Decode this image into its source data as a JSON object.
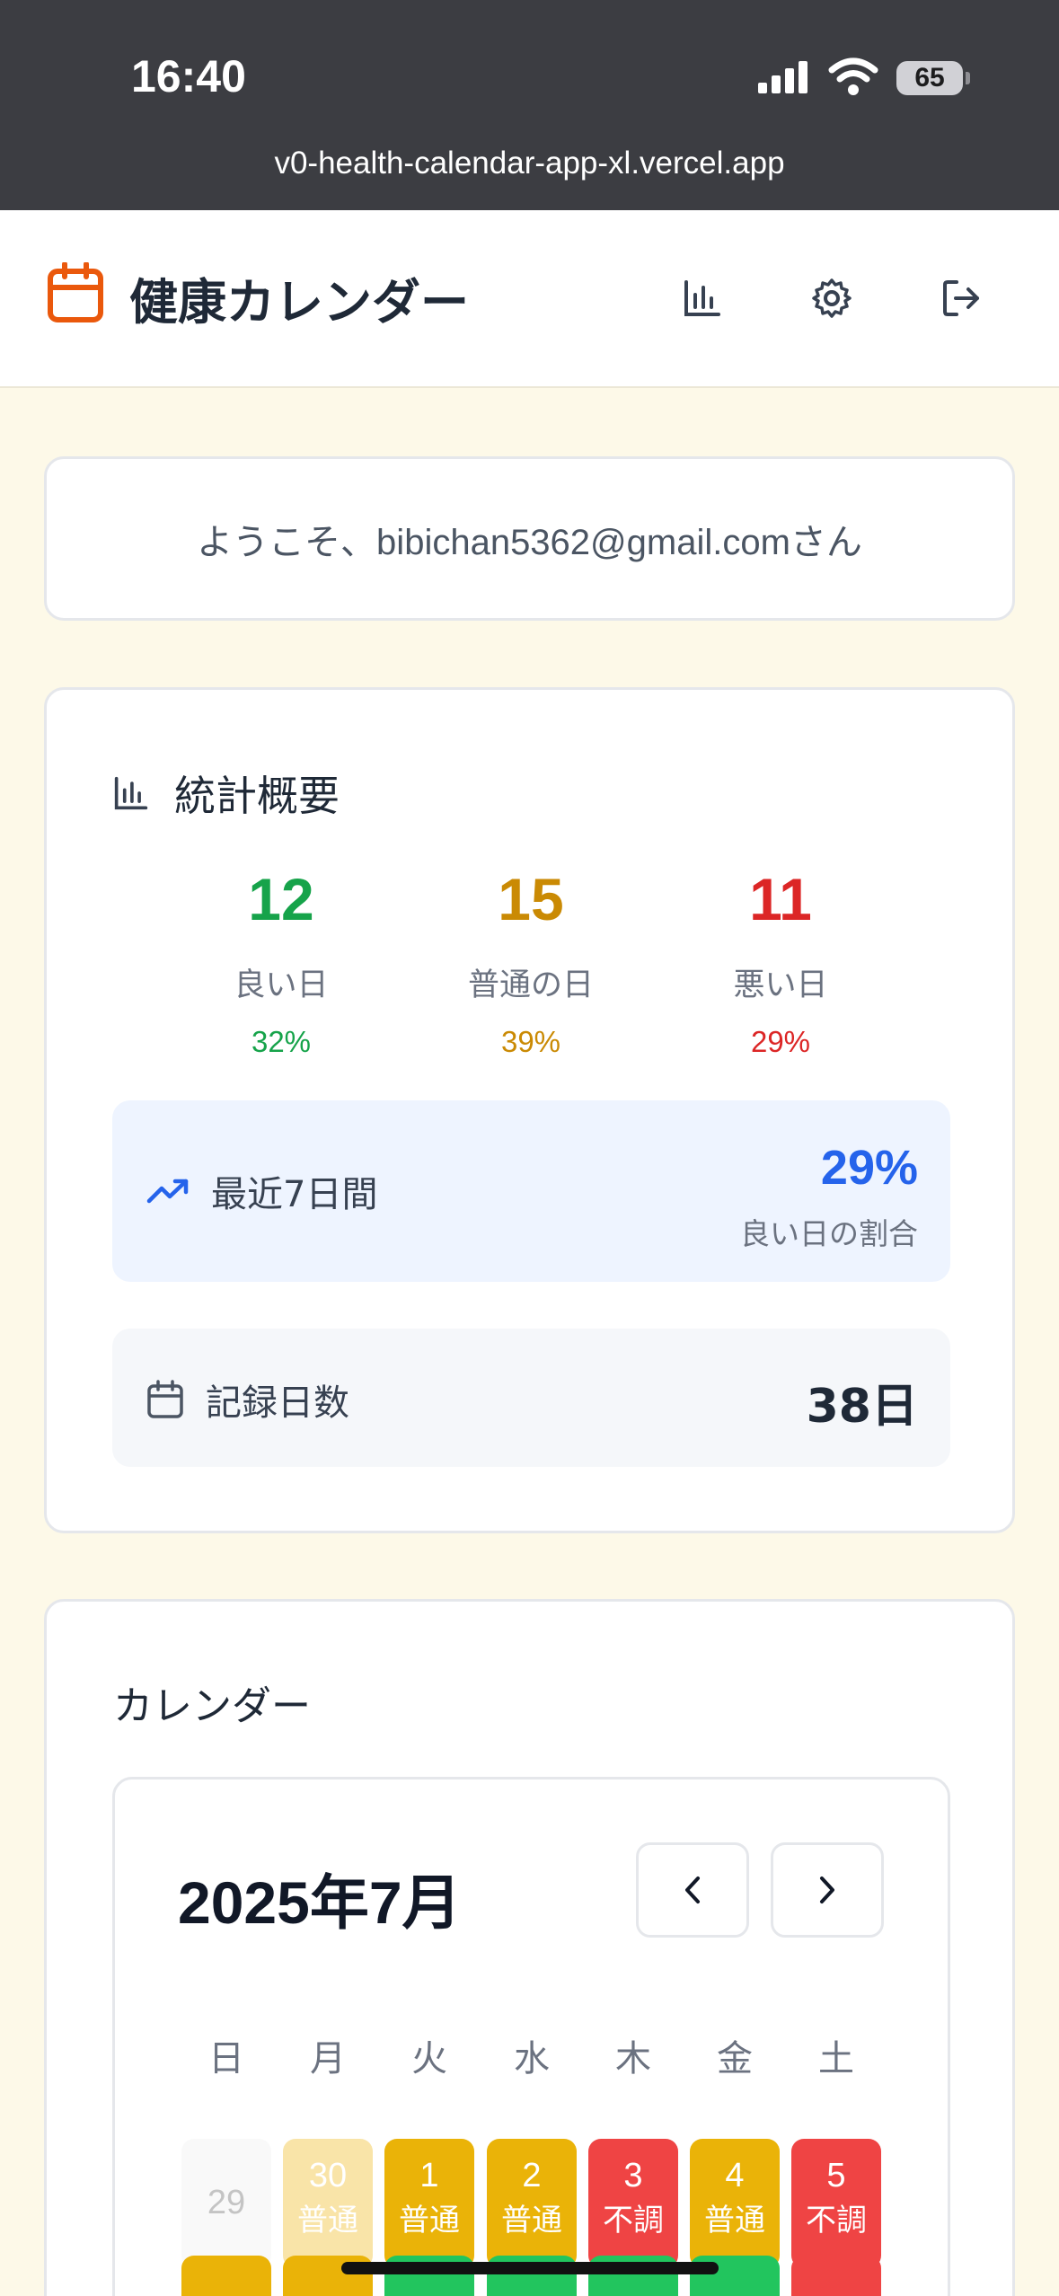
{
  "status_bar": {
    "time": "16:40",
    "battery": "65",
    "url": "v0-health-calendar-app-xl.vercel.app"
  },
  "header": {
    "title": "健康カレンダー",
    "icons": [
      "calendar-icon",
      "bar-chart-icon",
      "gear-icon",
      "logout-icon"
    ],
    "accent_color": "#ea580c"
  },
  "welcome": {
    "text": "ようこそ、bibichan5362@gmail.comさん"
  },
  "stats": {
    "title": "統計概要",
    "good": {
      "count": "12",
      "label": "良い日",
      "percent": "32%",
      "color": "#16a34a"
    },
    "normal": {
      "count": "15",
      "label": "普通の日",
      "percent": "39%",
      "color": "#ca8a04"
    },
    "bad": {
      "count": "11",
      "label": "悪い日",
      "percent": "29%",
      "color": "#dc2626"
    },
    "recent": {
      "label": "最近7日間",
      "percent": "29%",
      "sub": "良い日の割合"
    },
    "record": {
      "label": "記録日数",
      "value": "38日"
    }
  },
  "calendar": {
    "title": "カレンダー",
    "month": "2025年7月",
    "weekdays": [
      "日",
      "月",
      "火",
      "水",
      "木",
      "金",
      "土"
    ],
    "week1": [
      {
        "day": "29",
        "status": ""
      },
      {
        "day": "30",
        "status": "普通"
      },
      {
        "day": "1",
        "status": "普通"
      },
      {
        "day": "2",
        "status": "普通"
      },
      {
        "day": "3",
        "status": "不調"
      },
      {
        "day": "4",
        "status": "普通"
      },
      {
        "day": "5",
        "status": "不調"
      }
    ],
    "colors": {
      "normal": "#eab308",
      "bad": "#ef4444",
      "good": "#22c55e"
    }
  }
}
